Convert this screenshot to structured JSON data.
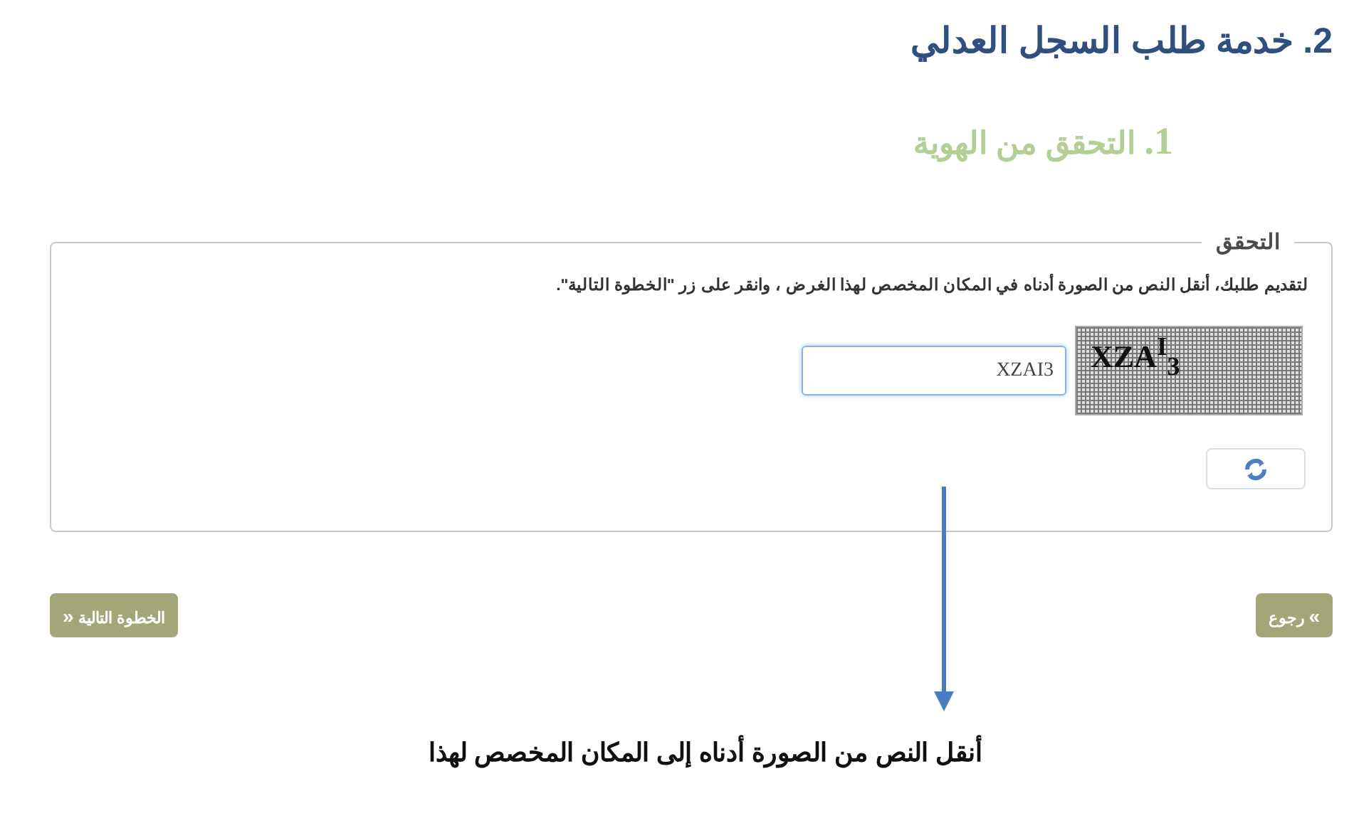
{
  "title": "2. خدمة طلب السجل العدلي",
  "step": {
    "number": "1.",
    "label": "التحقق من الهوية"
  },
  "verification": {
    "legend": "التحقق",
    "instruction": "لتقديم طلبك، أنقل النص من الصورة أدناه في المكان المخصص لهذا الغرض ، وانقر على زر \"الخطوة التالية\".",
    "input_value": "XZAI3",
    "captcha": "XZA$^{I}$$_{3}$"
  },
  "buttons": [
    {
      "kind": "back",
      "label": "رجوع",
      "chevron": "«"
    },
    {
      "kind": "next",
      "label": "الخطوة التالية",
      "chevron": "»"
    }
  ],
  "annotation": "أنقل النص من الصورة أدناه إلى المكان المخصص لهذا"
}
